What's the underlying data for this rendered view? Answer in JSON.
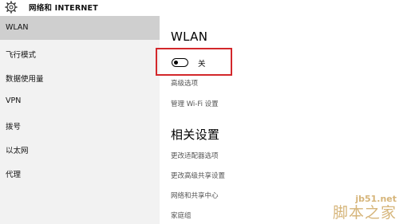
{
  "window": {
    "title": "网络和 INTERNET"
  },
  "sidebar": {
    "items": [
      {
        "label": "WLAN",
        "active": true
      },
      {
        "label": "飞行模式"
      },
      {
        "label": "数据使用量"
      },
      {
        "label": "VPN"
      },
      {
        "label": "拨号"
      },
      {
        "label": "以太网"
      },
      {
        "label": "代理"
      }
    ]
  },
  "main": {
    "heading": "WLAN",
    "toggle": {
      "state": "off",
      "label": "关"
    },
    "links": [
      "高级选项",
      "管理 Wi-Fi 设置"
    ],
    "related_heading": "相关设置",
    "related_links": [
      "更改适配器选项",
      "更改高级共享设置",
      "网络和共享中心",
      "家庭组"
    ]
  },
  "watermark": {
    "url": "jb51.net",
    "name": "脚本之家"
  },
  "colors": {
    "sidebar_bg": "#f2f2f2",
    "active_item_bg": "#cfcfcf",
    "highlight_border": "#d3272b",
    "watermark": "#d6b57a"
  }
}
